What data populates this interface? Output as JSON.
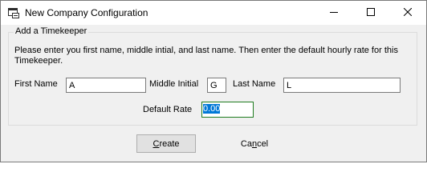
{
  "window": {
    "title": "New Company Configuration",
    "icons": {
      "app": "app-window-icon",
      "minimize": "minimize-icon",
      "maximize": "maximize-icon",
      "close": "close-icon"
    }
  },
  "group": {
    "title": "Add a Timekeeper",
    "instructions": "Please enter you first name, middle intial, and last name. Then enter the default hourly rate for this Timekeeper."
  },
  "fields": {
    "first_name": {
      "label": "First Name",
      "value": "A"
    },
    "middle_initial": {
      "label": "Middle Initial",
      "value": "G"
    },
    "last_name": {
      "label": "Last Name",
      "value": "L"
    },
    "default_rate": {
      "label": "Default Rate",
      "value": "0.00"
    }
  },
  "buttons": {
    "create": {
      "mnemonic": "C",
      "rest": "reate"
    },
    "cancel": {
      "pre": "Ca",
      "mnemonic": "n",
      "rest": "cel"
    }
  },
  "colors": {
    "focus_border": "#1e7b1e",
    "selection": "#0078d7"
  }
}
